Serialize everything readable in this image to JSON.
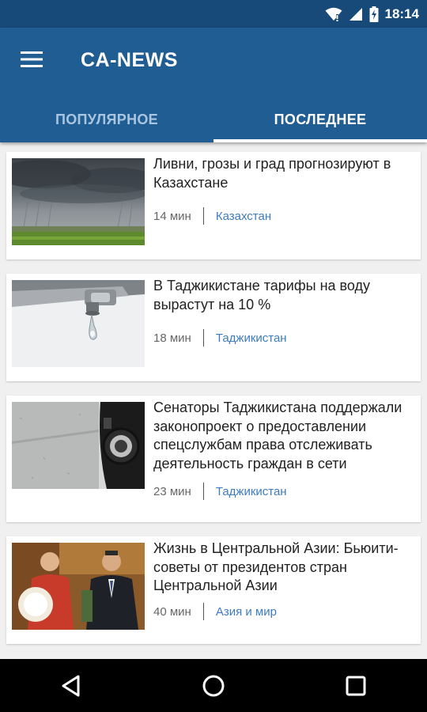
{
  "status_bar": {
    "time": "18:14",
    "icons": [
      "wifi-icon",
      "signal-icon",
      "battery-charging-icon"
    ]
  },
  "app_bar": {
    "menu_icon": "hamburger-menu-icon",
    "title": "CA-NEWS",
    "colors": {
      "primary": "#1f5d93",
      "status": "#174a78",
      "accent": "#3e7cc0"
    }
  },
  "tabs": [
    {
      "label": "ПОПУЛЯРНОЕ",
      "selected": false
    },
    {
      "label": "ПОСЛЕДНЕЕ",
      "selected": true
    }
  ],
  "articles": [
    {
      "title": "Ливни, грозы и град прогнозируют в Казахстане",
      "time": "14 мин",
      "category": "Казахстан",
      "image": "storm-clouds-over-field"
    },
    {
      "title": "В Таджикистане тарифы на воду вырастут на 10 %",
      "time": "18 мин",
      "category": "Таджикистан",
      "image": "water-tap-dripping"
    },
    {
      "title": "Сенаторы Таджикистана поддержали законопроект о предоставлении спецслужбам права отслеживать деятельность граждан в сети",
      "time": "23 мин",
      "category": "Таджикистан",
      "image": "surveillance-camera"
    },
    {
      "title": "Жизнь в Центральной Азии: Бьюити-советы от президентов стран Центральной Азии",
      "time": "40 мин",
      "category": "Азия и мир",
      "image": "presidents-photo"
    }
  ],
  "nav_bar": {
    "icons": [
      "back-icon",
      "home-icon",
      "recents-icon"
    ]
  }
}
